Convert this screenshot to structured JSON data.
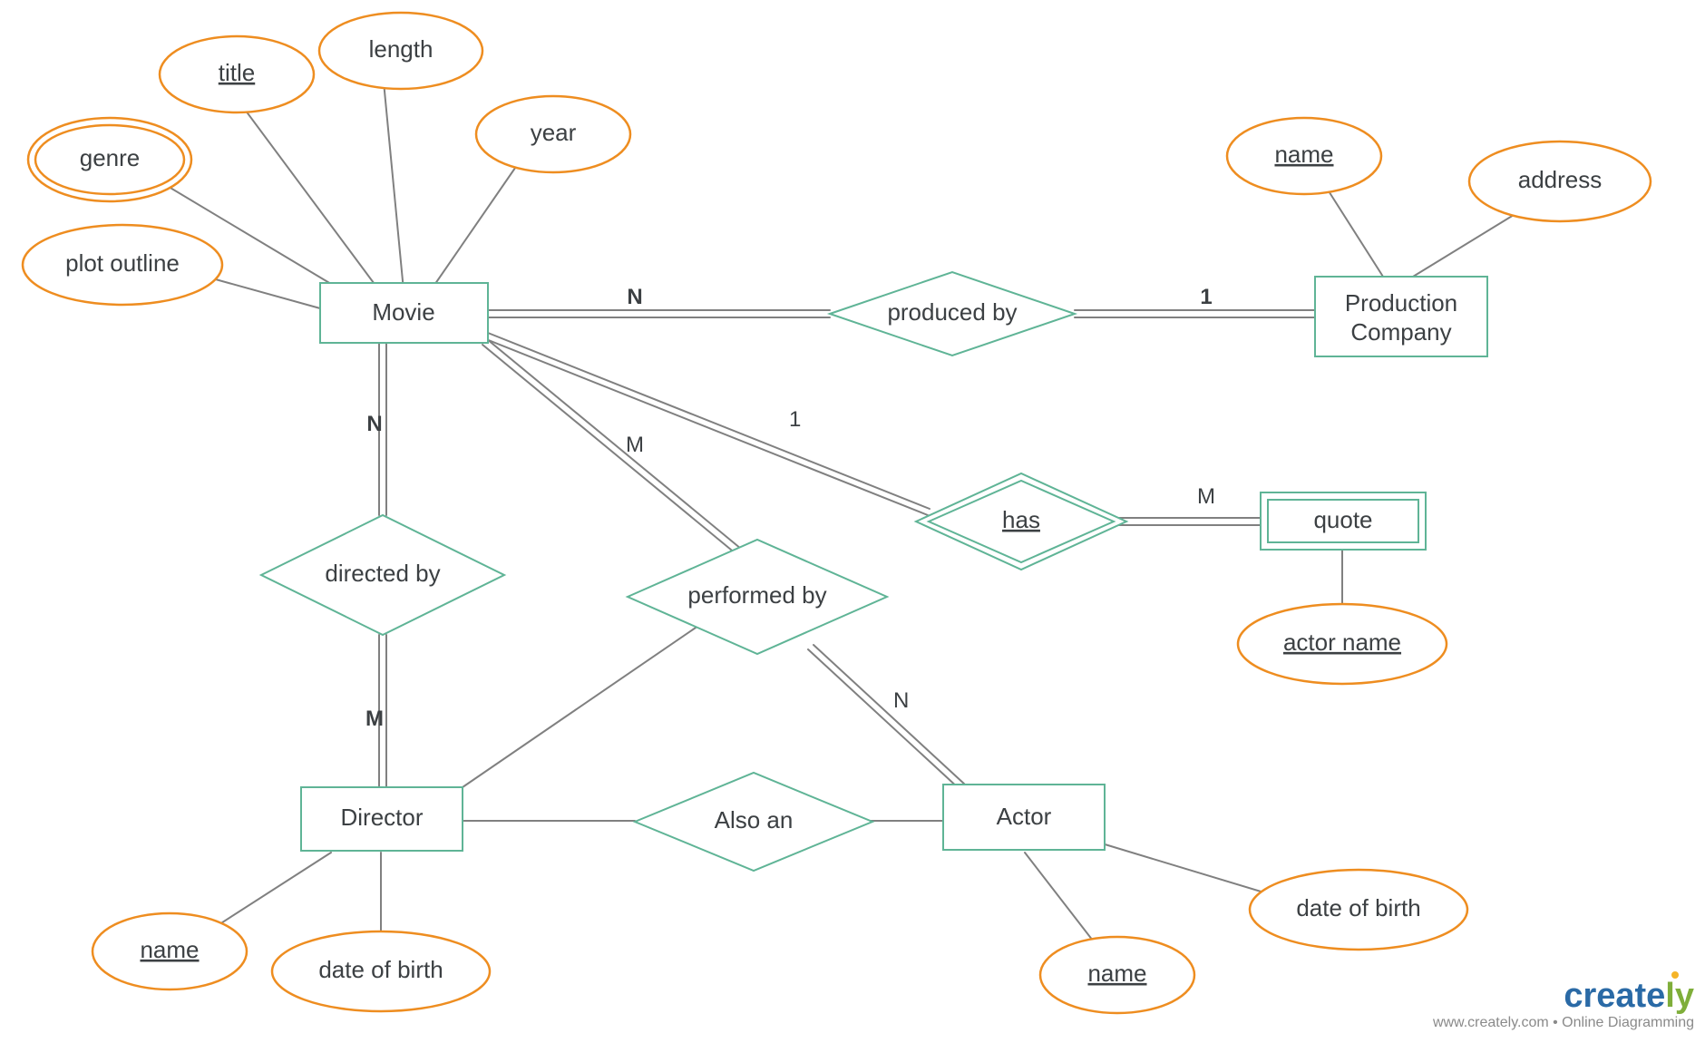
{
  "entities": {
    "movie": "Movie",
    "production_company_line1": "Production",
    "production_company_line2": "Company",
    "director": "Director",
    "actor": "Actor",
    "quote": "quote"
  },
  "attributes": {
    "genre": "genre",
    "title": "title",
    "length": "length",
    "year": "year",
    "plot_outline": "plot outline",
    "pc_name": "name",
    "pc_address": "address",
    "quote_actor_name": "actor name",
    "director_name": "name",
    "director_dob": "date of birth",
    "actor_name": "name",
    "actor_dob": "date of birth"
  },
  "relationships": {
    "produced_by": "produced by",
    "directed_by": "directed by",
    "performed_by": "performed by",
    "has": "has",
    "also_an": "Also an"
  },
  "cardinalities": {
    "movie_produced_N": "N",
    "produced_company_1": "1",
    "movie_directed_N": "N",
    "directed_director_M": "M",
    "movie_performed_M": "M",
    "performed_actor_N": "N",
    "movie_has_1": "1",
    "has_quote_M": "M"
  },
  "watermark": {
    "brand_part1": "create",
    "brand_part2": "ly",
    "sub": "www.creately.com • Online Diagramming"
  }
}
